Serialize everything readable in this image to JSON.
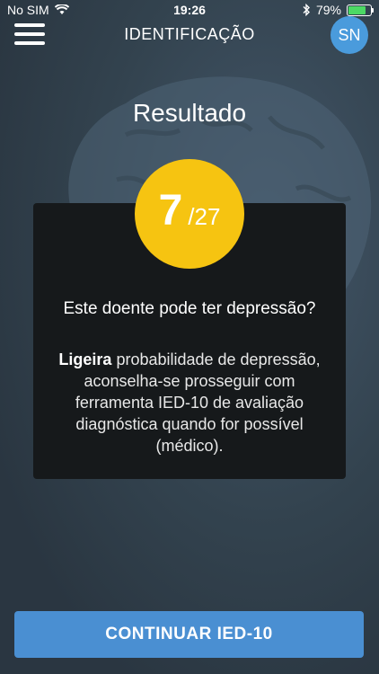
{
  "status_bar": {
    "carrier": "No SIM",
    "time": "19:26",
    "battery": "79%",
    "battery_level": 0.79
  },
  "nav": {
    "title": "IDENTIFICAÇÃO",
    "avatar_initials": "SN",
    "menu_icon": "hamburger-menu-icon"
  },
  "result": {
    "title": "Resultado",
    "score": "7",
    "score_max": "/27",
    "question": "Este doente pode ter depressão?",
    "severity": "Ligeira",
    "description": "probabilidade de depressão, aconselha-se prosseguir com ferramenta IED-10 de avaliação diagnóstica quando for possível (médico).",
    "score_color": "#f6c411"
  },
  "actions": {
    "continue_label": "CONTINUAR IED-10",
    "button_color": "#4a8fd2"
  }
}
